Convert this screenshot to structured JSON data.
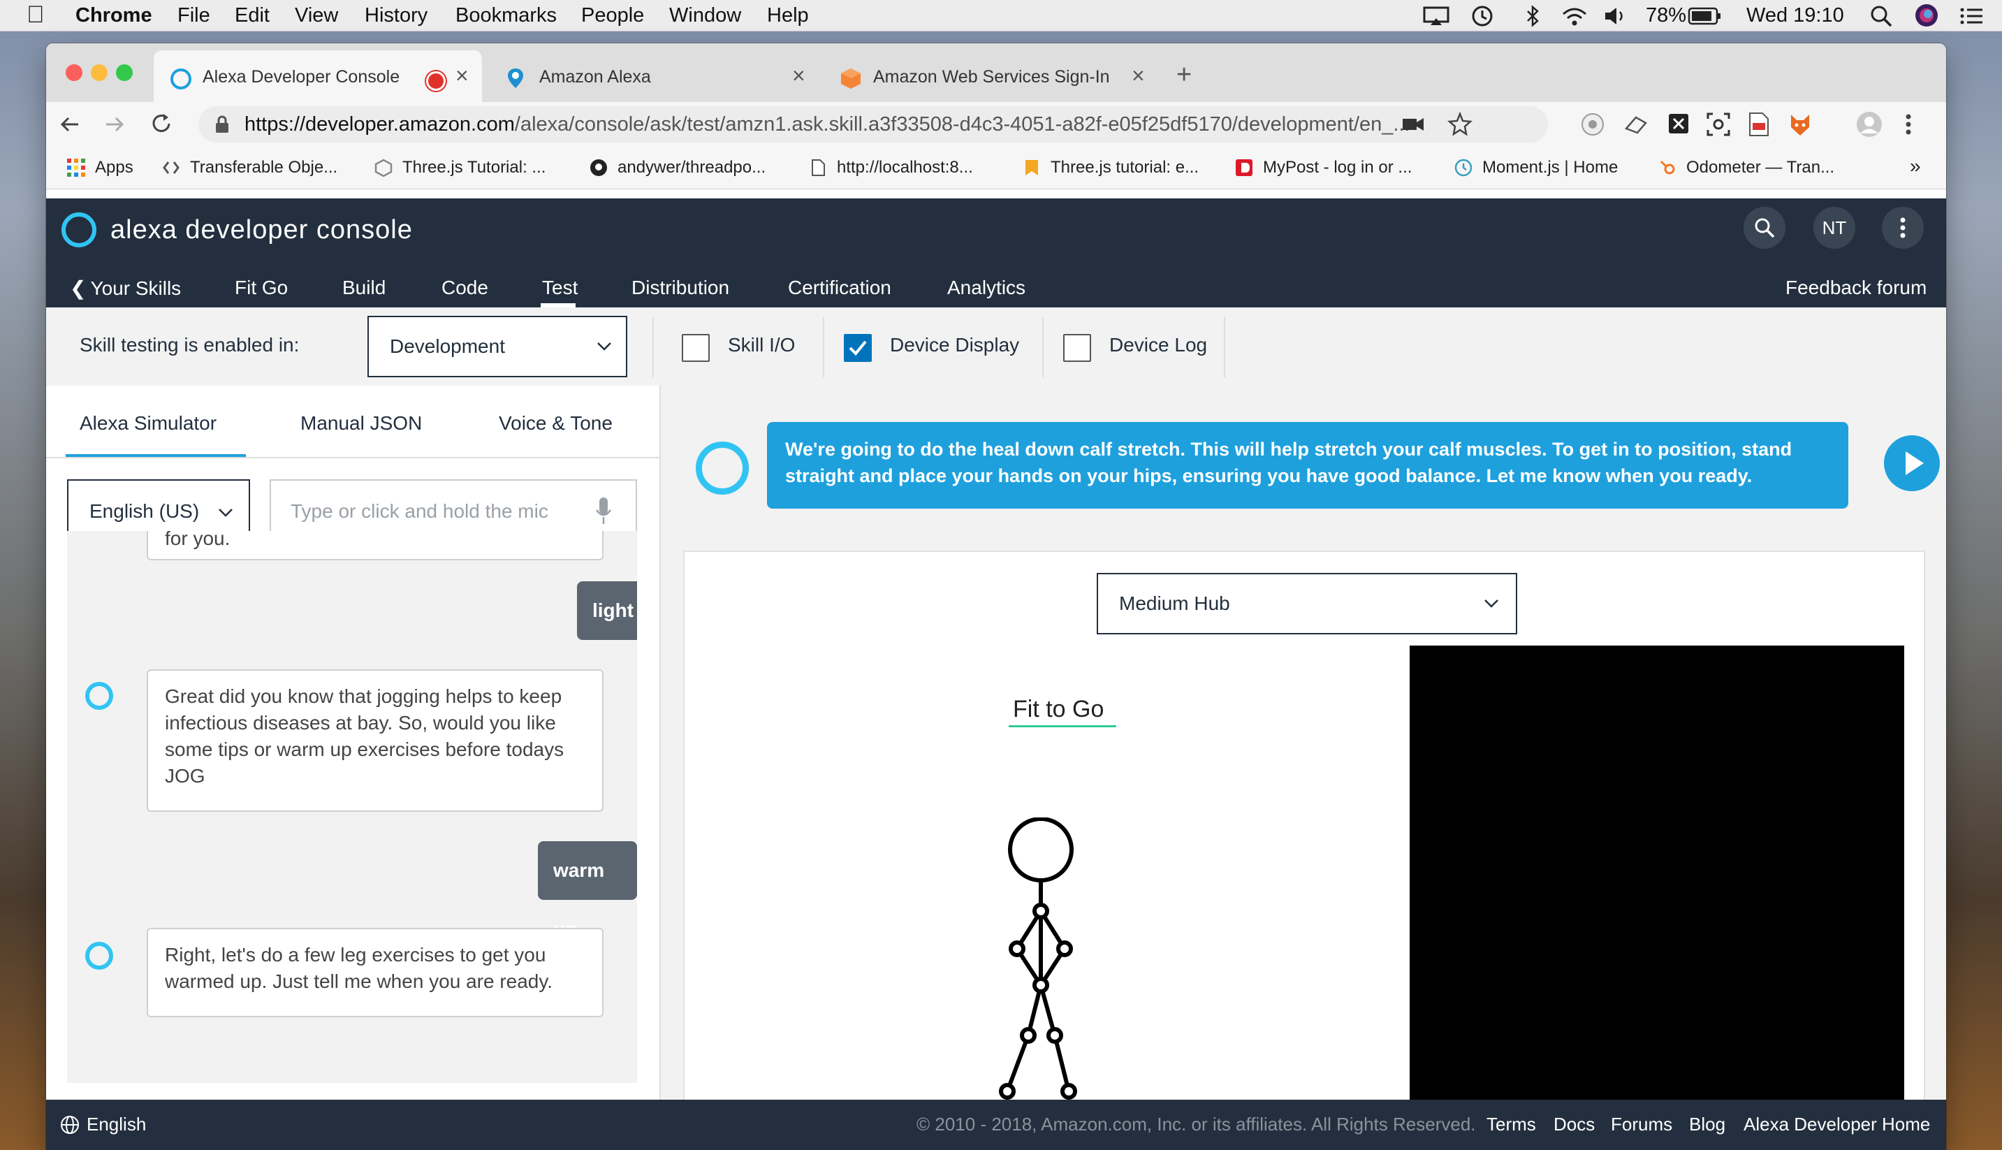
{
  "menubar": {
    "app": "Chrome",
    "items": [
      "File",
      "Edit",
      "View",
      "History",
      "Bookmarks",
      "People",
      "Window",
      "Help"
    ],
    "battery": "78%",
    "clock": "Wed 19:10"
  },
  "browser": {
    "tabs": [
      {
        "title": "Alexa Developer Console"
      },
      {
        "title": "Amazon Alexa"
      },
      {
        "title": "Amazon Web Services Sign-In"
      }
    ],
    "url_host": "https://developer.amazon.com",
    "url_path": "/alexa/console/ask/test/amzn1.ask.skill.a3f33508-d4c3-4051-a82f-e05f25df5170/development/en_...",
    "bookmarks": [
      "Apps",
      "Transferable Obje...",
      "Three.js Tutorial: ...",
      "andywer/threadpo...",
      "http://localhost:8...",
      "Three.js tutorial: e...",
      "MyPost - log in or ...",
      "Moment.js | Home",
      "Odometer — Tran..."
    ],
    "bookmarks_more": "»"
  },
  "console": {
    "logo_text": "alexa developer console",
    "avatar_initials": "NT",
    "nav": {
      "back": "Your Skills",
      "skill": "Fit Go",
      "build": "Build",
      "code": "Code",
      "test": "Test",
      "distribution": "Distribution",
      "certification": "Certification",
      "analytics": "Analytics",
      "feedback": "Feedback forum"
    }
  },
  "testing": {
    "label": "Skill testing is enabled in:",
    "stage": "Development",
    "options": [
      {
        "label": "Skill I/O",
        "checked": false
      },
      {
        "label": "Device Display",
        "checked": true
      },
      {
        "label": "Device Log",
        "checked": false
      }
    ]
  },
  "simulator": {
    "tabs": [
      "Alexa Simulator",
      "Manual JSON",
      "Voice & Tone"
    ],
    "locale": "English (US)",
    "input_placeholder": "Type or click and hold the mic",
    "conversation": {
      "partial_top": "for you.",
      "user_1": "light",
      "alexa_1": "Great did you know that jogging helps to keep infectious diseases at bay. So, would you like some tips or warm up exercises before todays JOG",
      "user_2": "warm up",
      "alexa_2": "Right, let's do a few leg exercises to get you warmed up. Just tell me when you are ready."
    }
  },
  "display": {
    "speech": "We're going to do the heal down calf stretch. This will help stretch your calf muscles. To get in to position, stand straight and place your hands on your hips, ensuring you have good balance. Let me know when you ready.",
    "device": "Medium Hub",
    "card_title": "Fit to Go"
  },
  "footer": {
    "language": "English",
    "copyright": "© 2010 - 2018, Amazon.com, Inc. or its affiliates. All Rights Reserved.",
    "links": [
      "Terms",
      "Docs",
      "Forums",
      "Blog",
      "Alexa Developer Home"
    ]
  },
  "colors": {
    "console_dark": "#232f3e",
    "alexa_blue": "#1ea0dd",
    "alexa_ring": "#31c4f3",
    "checkbox_blue": "#0073bb"
  }
}
